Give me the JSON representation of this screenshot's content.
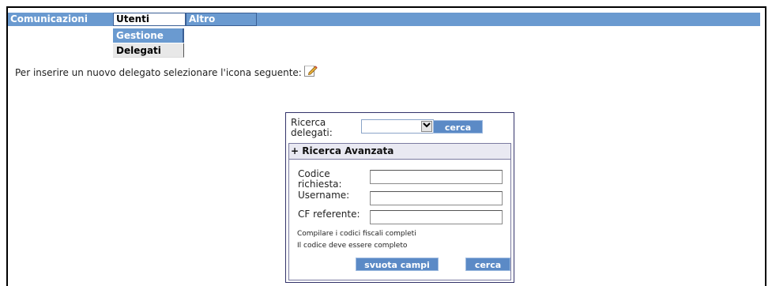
{
  "menu": {
    "items": [
      {
        "label": "Comunicazioni"
      },
      {
        "label": "Utenti"
      },
      {
        "label": "Altro"
      }
    ],
    "submenu": [
      {
        "label": "Gestione"
      },
      {
        "label": "Delegati"
      }
    ]
  },
  "instruction": "Per inserire un nuovo delegato selezionare l'icona seguente:",
  "search": {
    "label": "Ricerca delegati:",
    "select_value": "",
    "button": "cerca",
    "advanced": {
      "title": "+ Ricerca Avanzata",
      "fields": [
        {
          "label": "Codice richiesta:",
          "value": ""
        },
        {
          "label": "Username:",
          "value": ""
        },
        {
          "label": "CF referente:",
          "value": ""
        }
      ],
      "hints": [
        "Compilare i codici fiscali completi",
        "Il codice deve essere completo"
      ],
      "clear_button": "svuota campi",
      "search_button": "cerca"
    }
  },
  "colors": {
    "menu_bar": "#6a9ad0",
    "button": "#5b8ac6",
    "panel_border": "#33336a"
  },
  "icons": {
    "new_delegate": "edit-note-icon",
    "dropdown": "chevron-down-icon"
  }
}
